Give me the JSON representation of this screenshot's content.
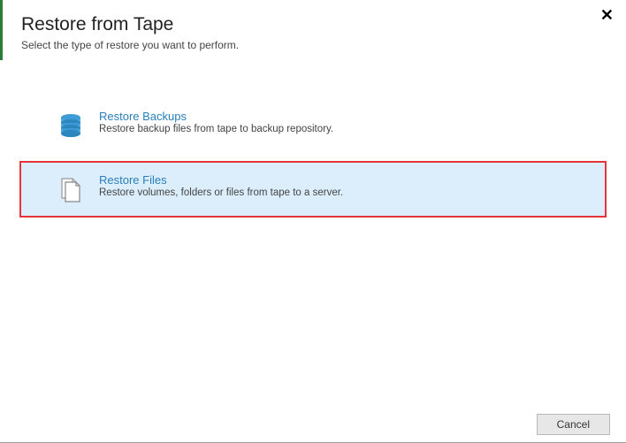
{
  "header": {
    "title": "Restore from Tape",
    "subtitle": "Select the type of restore you want to perform."
  },
  "options": [
    {
      "title": "Restore Backups",
      "desc": "Restore backup files from tape to backup repository."
    },
    {
      "title": "Restore Files",
      "desc": "Restore volumes, folders or files from tape to a server."
    }
  ],
  "buttons": {
    "cancel": "Cancel"
  }
}
